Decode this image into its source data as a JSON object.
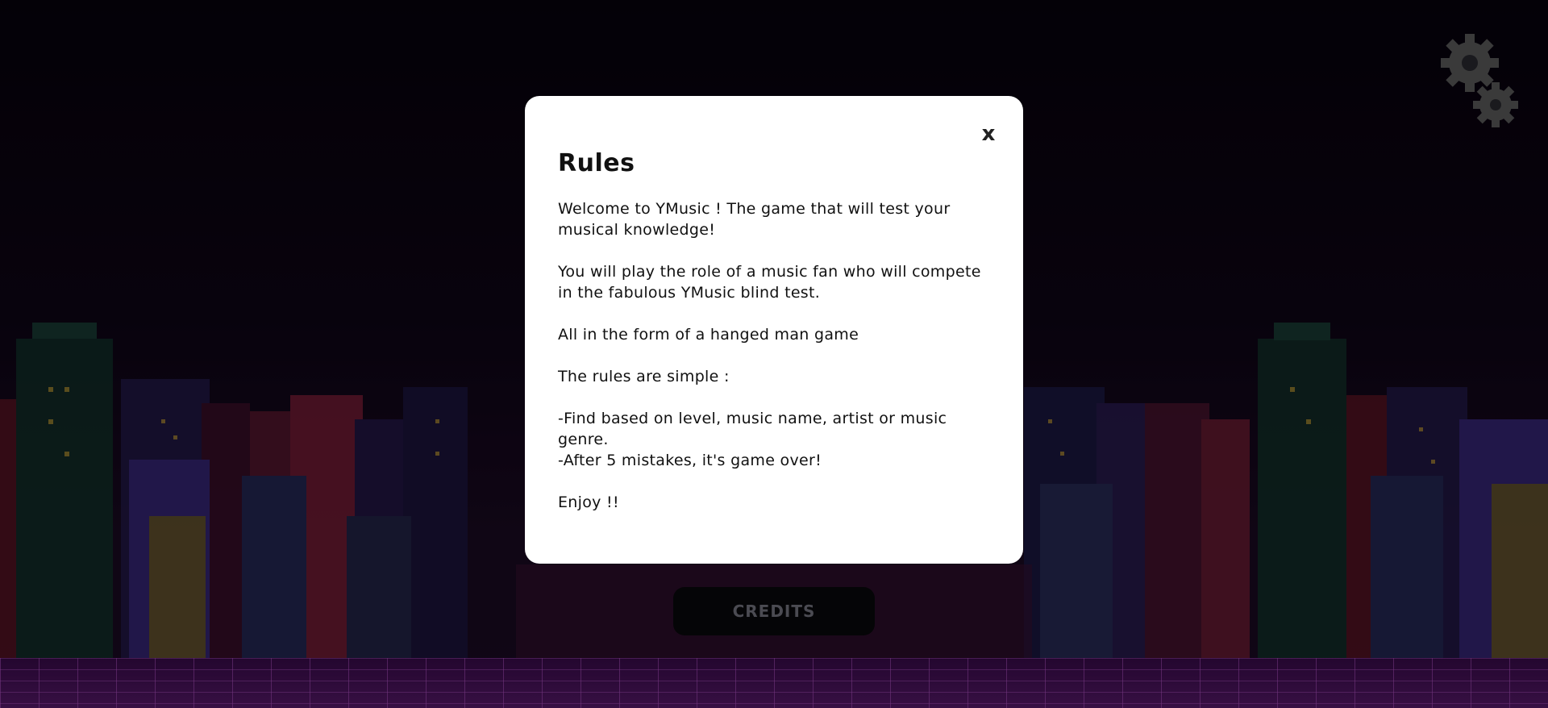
{
  "modal": {
    "title": "Rules",
    "close_label": "x",
    "paragraphs": [
      "Welcome to YMusic ! The game that will test your musical knowledge!",
      "You will play the role of a music fan who will compete in the fabulous YMusic blind test.",
      "All in the form of a hanged man game",
      "The rules are simple :",
      "-Find based on level, music name, artist or music genre.\n-After 5 mistakes, it's game over!",
      "Enjoy !!"
    ]
  },
  "credits_button": {
    "label": "CREDITS"
  },
  "icons": {
    "settings": "gears-icon",
    "close": "close-icon"
  },
  "colors": {
    "modal_bg": "#ffffff",
    "page_bg": "#0d0412",
    "floor": "#5a1a6e",
    "gear": "#3a3a3a"
  }
}
